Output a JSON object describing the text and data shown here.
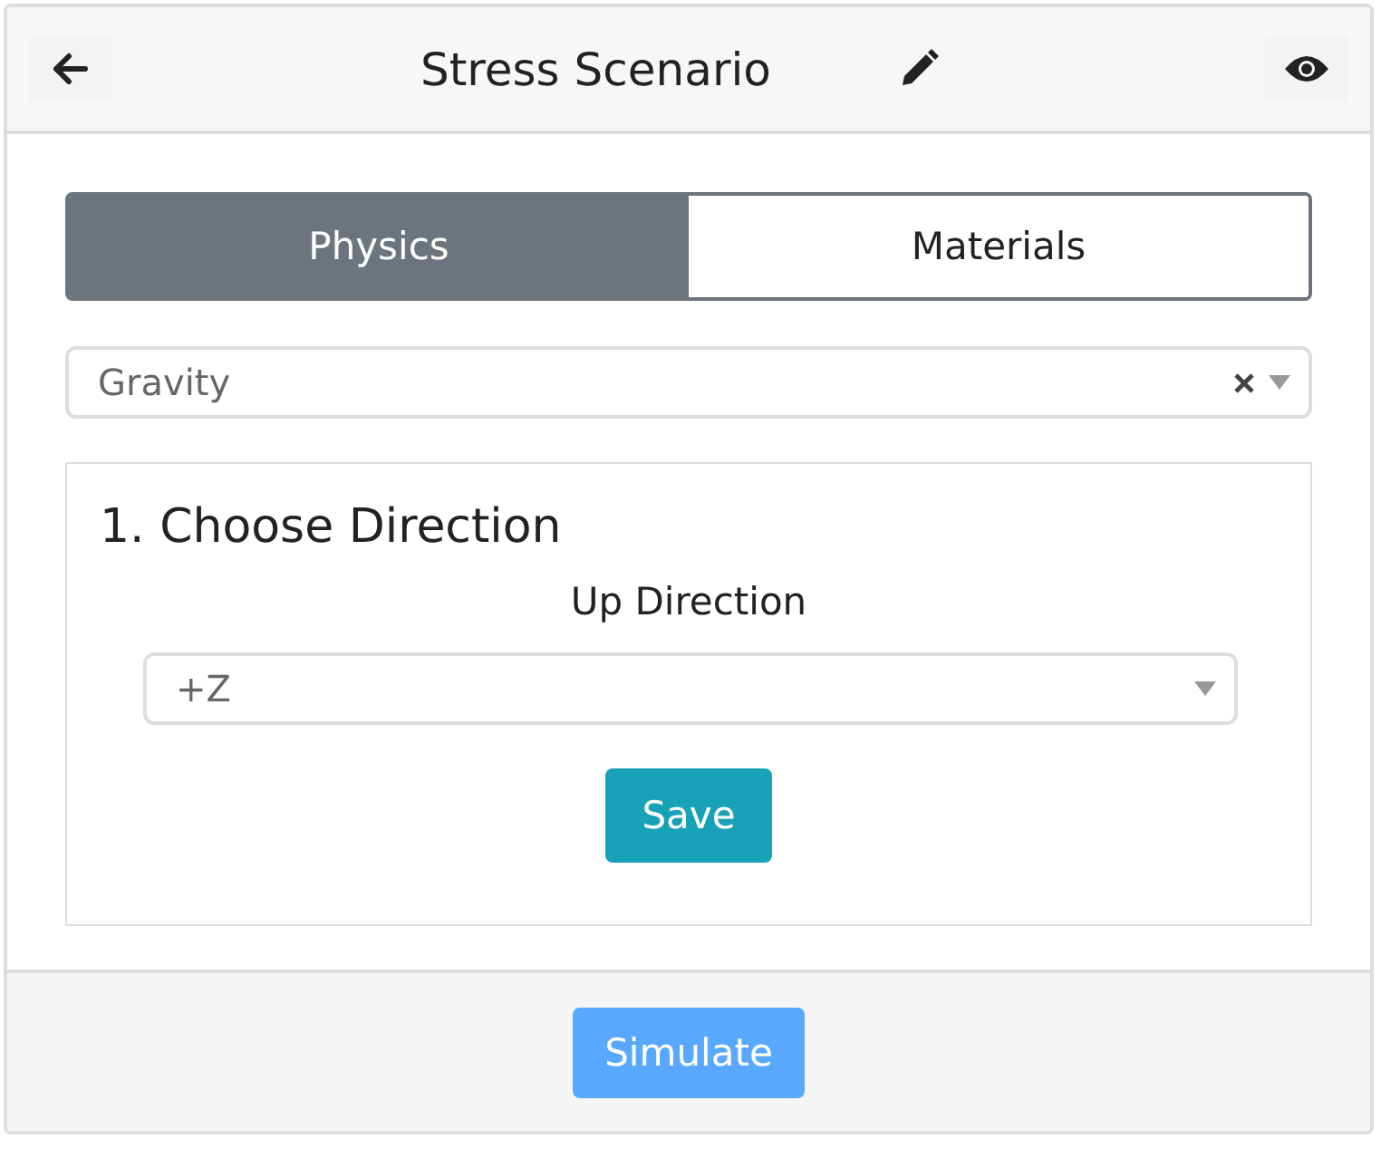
{
  "header": {
    "title": "Stress Scenario"
  },
  "tabs": [
    {
      "label": "Physics",
      "selected": true
    },
    {
      "label": "Materials",
      "selected": false
    }
  ],
  "physics_select": {
    "value": "Gravity",
    "clearable": true
  },
  "step": {
    "title": "1. Choose Direction",
    "field_label": "Up Direction",
    "select_value": "+Z",
    "save_label": "Save"
  },
  "footer": {
    "button": "Simulate"
  }
}
